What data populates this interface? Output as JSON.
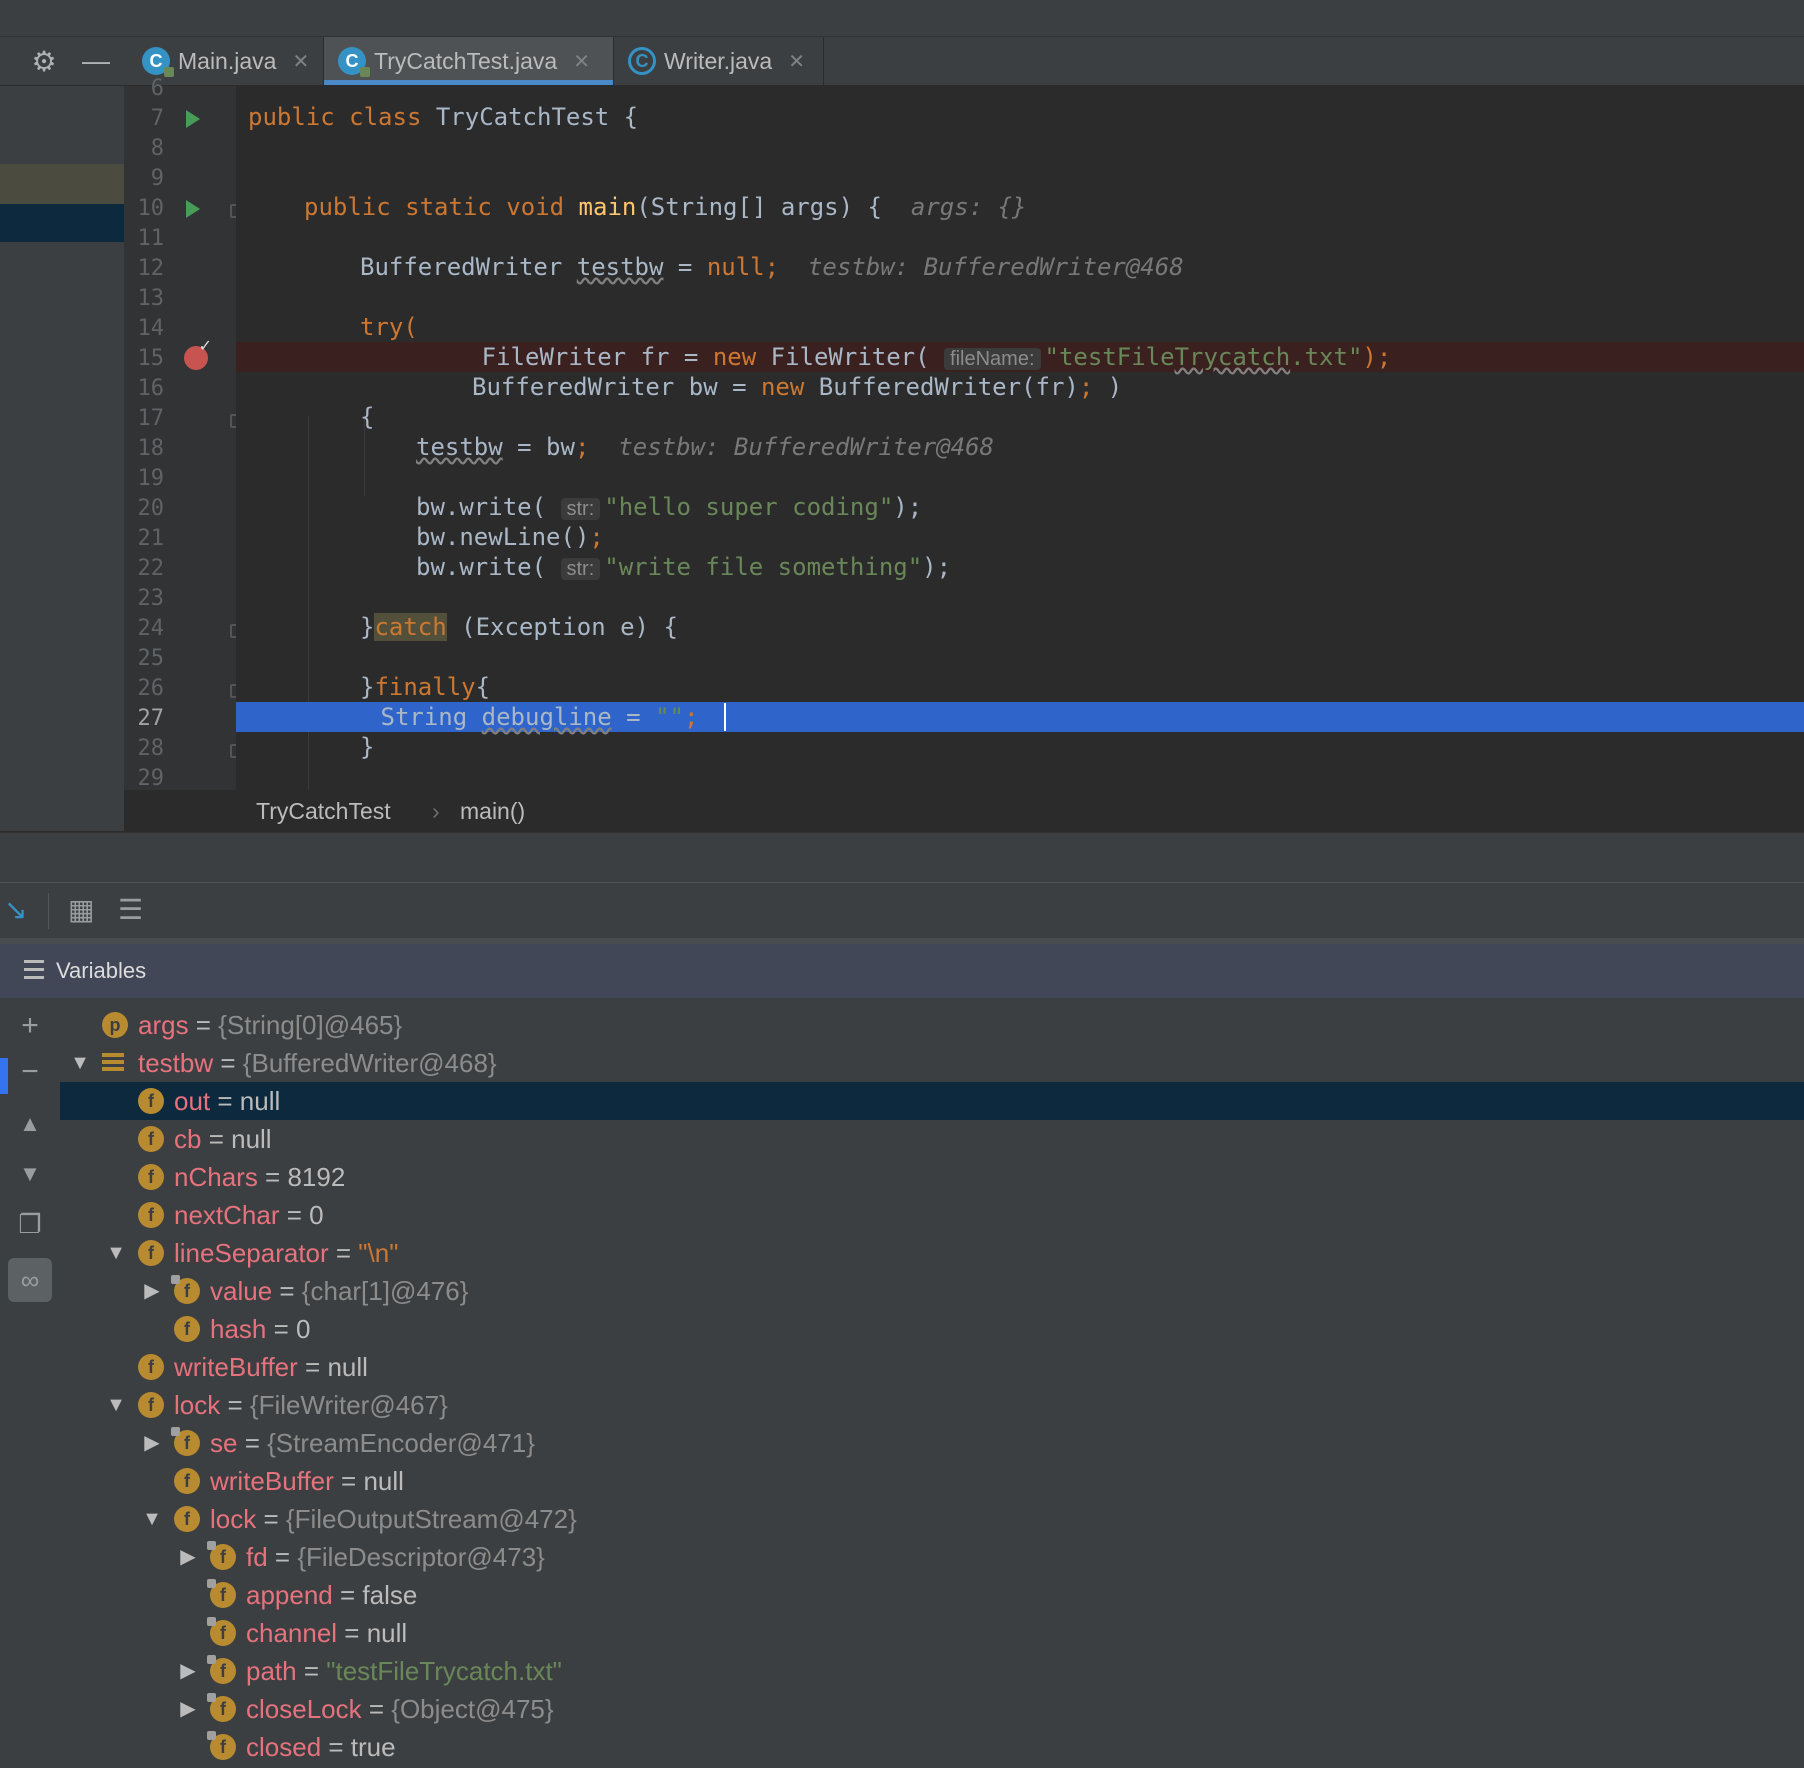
{
  "tabs": [
    {
      "label": "Main.java",
      "icon": "class-icon",
      "active": false
    },
    {
      "label": "TryCatchTest.java",
      "icon": "class-icon",
      "active": true
    },
    {
      "label": "Writer.java",
      "icon": "abstract-class-icon",
      "active": false
    }
  ],
  "editor": {
    "line_numbers": [
      "6",
      "7",
      "8",
      "9",
      "10",
      "11",
      "12",
      "13",
      "14",
      "15",
      "16",
      "17",
      "18",
      "19",
      "20",
      "21",
      "22",
      "23",
      "24",
      "25",
      "26",
      "27",
      "28",
      "29"
    ],
    "current_line": "27",
    "code": {
      "l7": {
        "kw": "public class ",
        "name": "TryCatchTest {"
      },
      "l10": {
        "kw": "public static void ",
        "fn": "main",
        "rest": "(String[] args) {",
        "hint": "args: {}"
      },
      "l12": {
        "type": "BufferedWriter ",
        "var": "testbw",
        "eq": " = ",
        "kw": "null;",
        "hint": "testbw: BufferedWriter@468"
      },
      "l14": {
        "kw": "try("
      },
      "l15": {
        "pre": "FileWriter fr = ",
        "kw": "new",
        "mid": " FileWriter( ",
        "param": "fileName:",
        "str1": "\"testFile",
        "strund": "Trycatch",
        "str2": ".txt\"",
        "end": ");"
      },
      "l16": {
        "pre": "BufferedWriter bw = ",
        "kw": "new",
        "mid": " BufferedWriter(fr)",
        "semi": ";",
        "end": " )"
      },
      "l17": {
        "text": "{"
      },
      "l18": {
        "var": "testbw",
        "rest": " = bw",
        "semi": ";",
        "hint": "testbw: BufferedWriter@468"
      },
      "l20": {
        "pre": "bw.write( ",
        "param": "str:",
        "str": "\"hello super coding\"",
        "end": ");"
      },
      "l21": {
        "pre": "bw.newLine()",
        "semi": ";"
      },
      "l22": {
        "pre": "bw.write( ",
        "param": "str:",
        "str": "\"write file something\"",
        "end": ");"
      },
      "l24": {
        "pre": "}",
        "kw": "catch",
        "rest": " (Exception e) {"
      },
      "l26": {
        "pre": "}",
        "kw": "finally",
        "rest": "{"
      },
      "l27": {
        "pre": "String ",
        "var": "debugline",
        "eq": " = ",
        "str": "\"\"",
        "semi": ";"
      },
      "l28": {
        "text": "}"
      }
    }
  },
  "breadcrumb": [
    "TryCatchTest",
    "main()"
  ],
  "variables_panel": {
    "title": "Variables",
    "rows": [
      {
        "expander": "",
        "icon": "p",
        "name": "args",
        "value": "{String[0]@465}",
        "style": "ref"
      },
      {
        "expander": "▼",
        "icon": "bars",
        "name": "testbw",
        "value": "{BufferedWriter@468}",
        "style": "ref"
      },
      {
        "expander": "",
        "icon": "f",
        "name": "out",
        "value": "null",
        "style": "plain",
        "selected": true
      },
      {
        "expander": "",
        "icon": "f",
        "name": "cb",
        "value": "null",
        "style": "plain"
      },
      {
        "expander": "",
        "icon": "f",
        "name": "nChars",
        "value": "8192",
        "style": "plain"
      },
      {
        "expander": "",
        "icon": "f",
        "name": "nextChar",
        "value": "0",
        "style": "plain"
      },
      {
        "expander": "▼",
        "icon": "f",
        "name": "lineSeparator",
        "value": "\"\\n\"",
        "style": "stro"
      },
      {
        "expander": "▶",
        "icon": "f-lock",
        "name": "value",
        "value": "{char[1]@476}",
        "style": "ref"
      },
      {
        "expander": "",
        "icon": "f",
        "name": "hash",
        "value": "0",
        "style": "plain"
      },
      {
        "expander": "",
        "icon": "f",
        "name": "writeBuffer",
        "value": "null",
        "style": "plain"
      },
      {
        "expander": "▼",
        "icon": "f",
        "name": "lock",
        "value": "{FileWriter@467}",
        "style": "ref"
      },
      {
        "expander": "▶",
        "icon": "f-lock",
        "name": "se",
        "value": "{StreamEncoder@471}",
        "style": "ref"
      },
      {
        "expander": "",
        "icon": "f",
        "name": "writeBuffer",
        "value": "null",
        "style": "plain"
      },
      {
        "expander": "▼",
        "icon": "f",
        "name": "lock",
        "value": "{FileOutputStream@472}",
        "style": "ref"
      },
      {
        "expander": "▶",
        "icon": "f-lock",
        "name": "fd",
        "value": "{FileDescriptor@473}",
        "style": "ref"
      },
      {
        "expander": "",
        "icon": "f-lock",
        "name": "append",
        "value": "false",
        "style": "plain"
      },
      {
        "expander": "",
        "icon": "f-lock",
        "name": "channel",
        "value": "null",
        "style": "plain"
      },
      {
        "expander": "▶",
        "icon": "f-lock",
        "name": "path",
        "value": "\"testFileTrycatch.txt\"",
        "style": "str"
      },
      {
        "expander": "▶",
        "icon": "f-lock",
        "name": "closeLock",
        "value": "{Object@475}",
        "style": "ref"
      },
      {
        "expander": "",
        "icon": "f-lock",
        "name": "closed",
        "value": "true",
        "style": "plain"
      }
    ]
  },
  "colors": {
    "keyword": "#cc7832",
    "string": "#6a8759",
    "selection": "#2f65ca",
    "breakpoint": "#c75450",
    "var_name": "#e5727d"
  }
}
